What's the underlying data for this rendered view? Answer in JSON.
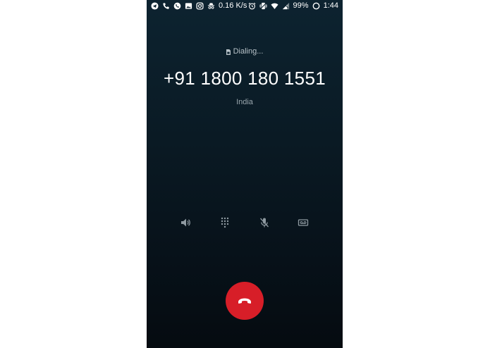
{
  "status_bar": {
    "left_icons": [
      "telegram-icon",
      "phone-icon",
      "whatsapp-icon",
      "image-icon",
      "instagram-icon",
      "incognito-icon"
    ],
    "network_speed": "0.16 K/s",
    "right_icons": [
      "alarm-icon",
      "vibrate-icon",
      "wifi-icon",
      "signal-icon"
    ],
    "battery": "99%",
    "time": "1:44"
  },
  "call": {
    "status": "Dialing...",
    "number": "+91 1800 180 1551",
    "location": "India"
  },
  "controls": {
    "items": [
      "speaker-icon",
      "dialpad-icon",
      "mute-icon",
      "hold-icon"
    ]
  },
  "end_call": {
    "icon": "end-call-icon",
    "color": "#d71e28"
  }
}
